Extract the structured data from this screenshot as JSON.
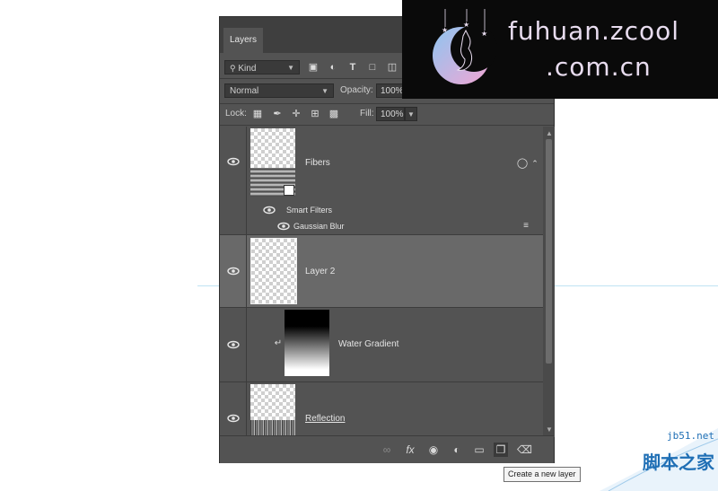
{
  "panel": {
    "tab_label": "Layers",
    "filter": {
      "kind_label": "Kind",
      "icons": [
        "image-filter-icon",
        "adjustment-filter-icon",
        "type-filter-icon",
        "shape-filter-icon",
        "smart-object-filter-icon"
      ]
    },
    "blend": {
      "mode": "Normal",
      "opacity_label": "Opacity:",
      "opacity_value": "100%"
    },
    "lock": {
      "label": "Lock:",
      "icons": [
        "lock-transparent-icon",
        "lock-image-icon",
        "lock-position-icon",
        "lock-artboard-icon",
        "lock-all-icon"
      ],
      "fill_label": "Fill:",
      "fill_value": "100%"
    },
    "layers": [
      {
        "name": "Fibers",
        "type": "smart-object",
        "visible": true,
        "selected": false,
        "smart_filters_label": "Smart Filters",
        "filters": [
          {
            "name": "Gaussian Blur"
          }
        ]
      },
      {
        "name": "Layer 2",
        "type": "pixel",
        "visible": true,
        "selected": true
      },
      {
        "name": "Water Gradient",
        "type": "clipped-gradient",
        "visible": true,
        "selected": false
      },
      {
        "name": "Reflection",
        "type": "pixel",
        "visible": true,
        "selected": false
      }
    ],
    "bottom_icons": [
      "link-layers-icon",
      "fx-icon",
      "layer-mask-icon",
      "adjustment-layer-icon",
      "group-folder-icon",
      "new-layer-icon",
      "trash-icon"
    ]
  },
  "tooltip": {
    "text": "Create a new layer"
  },
  "watermark": {
    "line1": "fuhuan.zcool",
    "line2": ".com.cn"
  },
  "watermark2": {
    "site": "jb51.net",
    "cn": "脚本之家"
  },
  "colors": {
    "panel_bg": "#535353",
    "selected_row": "#696969",
    "tab_bar": "#3f3f3f",
    "guide": "#bfe3f3",
    "watermark_text": "#e8dcef",
    "jb51_blue": "#1f6fb5"
  }
}
